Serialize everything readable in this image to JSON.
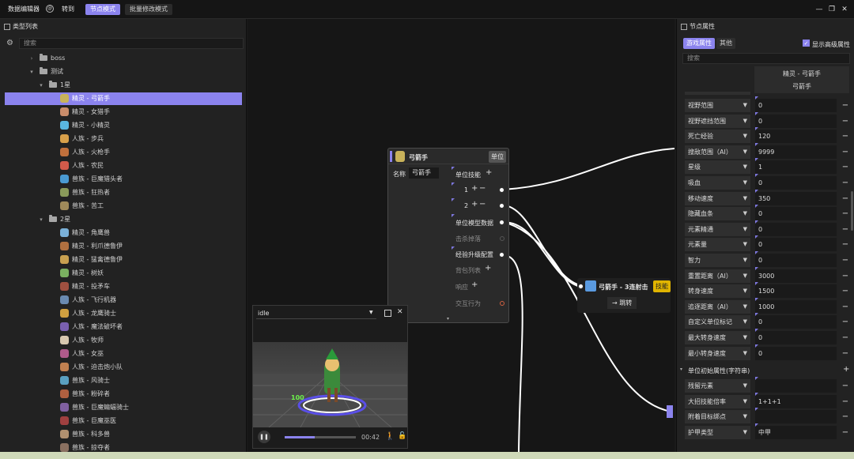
{
  "topbar": {
    "app_title": "数据编辑器",
    "goto_label": "转到",
    "mode_node": "节点模式",
    "mode_batch": "批量修改模式"
  },
  "left_panel": {
    "title": "类型列表",
    "search_placeholder": "搜索",
    "tree": [
      {
        "label": "boss",
        "type": "folder",
        "level": 2,
        "expanded": false
      },
      {
        "label": "测试",
        "type": "folder",
        "level": 2,
        "expanded": true
      },
      {
        "label": "1星",
        "type": "folder",
        "level": 3,
        "expanded": true
      },
      {
        "label": "精灵 - 弓箭手",
        "type": "item",
        "level": 4,
        "selected": true,
        "color": "#c8b25a"
      },
      {
        "label": "精灵 - 女猎手",
        "type": "item",
        "level": 4,
        "color": "#c98c6a"
      },
      {
        "label": "精灵 - 小精灵",
        "type": "item",
        "level": 4,
        "color": "#5ab6e0"
      },
      {
        "label": "人族 - 步兵",
        "type": "item",
        "level": 4,
        "color": "#d8a04a"
      },
      {
        "label": "人族 - 火枪手",
        "type": "item",
        "level": 4,
        "color": "#c0703c"
      },
      {
        "label": "人族 - 农民",
        "type": "item",
        "level": 4,
        "color": "#d25a4a"
      },
      {
        "label": "兽族 - 巨魔猎头者",
        "type": "item",
        "level": 4,
        "color": "#4a9ad2"
      },
      {
        "label": "兽族 - 狂热者",
        "type": "item",
        "level": 4,
        "color": "#8a9a5a"
      },
      {
        "label": "兽族 - 苦工",
        "type": "item",
        "level": 4,
        "color": "#a08a5a"
      },
      {
        "label": "2星",
        "type": "folder",
        "level": 3,
        "expanded": true
      },
      {
        "label": "精灵 - 角鹰兽",
        "type": "item",
        "level": 4,
        "color": "#7ab0d8"
      },
      {
        "label": "精灵 - 利爪德鲁伊",
        "type": "item",
        "level": 4,
        "color": "#b07040"
      },
      {
        "label": "精灵 - 猛禽德鲁伊",
        "type": "item",
        "level": 4,
        "color": "#c8a050"
      },
      {
        "label": "精灵 - 树妖",
        "type": "item",
        "level": 4,
        "color": "#7ab060"
      },
      {
        "label": "精灵 - 投矛车",
        "type": "item",
        "level": 4,
        "color": "#a05040"
      },
      {
        "label": "人族 - 飞行机器",
        "type": "item",
        "level": 4,
        "color": "#6a8ab0"
      },
      {
        "label": "人族 - 龙鹰骑士",
        "type": "item",
        "level": 4,
        "color": "#d0a040"
      },
      {
        "label": "人族 - 魔法破坏者",
        "type": "item",
        "level": 4,
        "color": "#7a60b0"
      },
      {
        "label": "人族 - 牧师",
        "type": "item",
        "level": 4,
        "color": "#d8c8b0"
      },
      {
        "label": "人族 - 女巫",
        "type": "item",
        "level": 4,
        "color": "#b05a8a"
      },
      {
        "label": "人族 - 迫击炮小队",
        "type": "item",
        "level": 4,
        "color": "#c08050"
      },
      {
        "label": "兽族 - 风骑士",
        "type": "item",
        "level": 4,
        "color": "#5aa0c0"
      },
      {
        "label": "兽族 - 粉碎者",
        "type": "item",
        "level": 4,
        "color": "#b06040"
      },
      {
        "label": "兽族 - 巨魔蝙蝠骑士",
        "type": "item",
        "level": 4,
        "color": "#8060a0"
      },
      {
        "label": "兽族 - 巨魔巫医",
        "type": "item",
        "level": 4,
        "color": "#a04040"
      },
      {
        "label": "兽族 - 科多兽",
        "type": "item",
        "level": 4,
        "color": "#b09070"
      },
      {
        "label": "兽族 - 掠夺者",
        "type": "item",
        "level": 4,
        "color": "#8a7060"
      }
    ]
  },
  "unit_node": {
    "title": "弓箭手",
    "badge": "单位",
    "name_label": "名称",
    "name_value": "弓箭手",
    "unit_skills_label": "单位技能",
    "skill_1": "1",
    "skill_2": "2",
    "model_data": "单位模型数据",
    "kill_drop": "击杀掉落",
    "exp_upgrade": "经验升级配置",
    "backpack_list": "背包列表",
    "response": "响应",
    "interaction": "交互行为"
  },
  "skill_node": {
    "title": "弓箭手 - 3连射击",
    "badge": "技能",
    "jump_label": "跳转"
  },
  "preview": {
    "animation": "idle",
    "time": "00:42",
    "progress": 0.42,
    "floating_number": "100"
  },
  "right_panel": {
    "title": "节点属性",
    "tab_game": "游戏属性",
    "tab_other": "其他",
    "show_advanced": "显示高级属性",
    "search_placeholder": "搜索",
    "header_line1": "精灵 - 弓箭手",
    "header_line2": "弓箭手",
    "props": [
      {
        "name": "视野范围",
        "value": "0"
      },
      {
        "name": "视野遮挡范围",
        "value": "0"
      },
      {
        "name": "死亡经验",
        "value": "120"
      },
      {
        "name": "搜敌范围（AI）",
        "value": "9999"
      },
      {
        "name": "星级",
        "value": "1"
      },
      {
        "name": "吸血",
        "value": "0"
      },
      {
        "name": "移动速度",
        "value": "350"
      },
      {
        "name": "隐藏血条",
        "value": "0"
      },
      {
        "name": "元素精通",
        "value": "0"
      },
      {
        "name": "元素量",
        "value": "0"
      },
      {
        "name": "智力",
        "value": "0"
      },
      {
        "name": "重置距离（AI）",
        "value": "3000"
      },
      {
        "name": "转身速度",
        "value": "1500"
      },
      {
        "name": "追逐距离（AI）",
        "value": "1000"
      },
      {
        "name": "自定义单位标记",
        "value": "0"
      },
      {
        "name": "最大转身速度",
        "value": "0"
      },
      {
        "name": "最小转身速度",
        "value": "0"
      }
    ],
    "section_title": "单位初始属性(字符串)",
    "section_props": [
      {
        "name": "残留元素",
        "value": ""
      },
      {
        "name": "大招技能倍率",
        "value": "1+1+1"
      },
      {
        "name": "附着目标绑点",
        "value": ""
      },
      {
        "name": "护甲类型",
        "value": "中甲"
      }
    ]
  },
  "colors": {
    "accent": "#8b83ee",
    "skill_badge": "#e0b400",
    "background": "#161616"
  }
}
